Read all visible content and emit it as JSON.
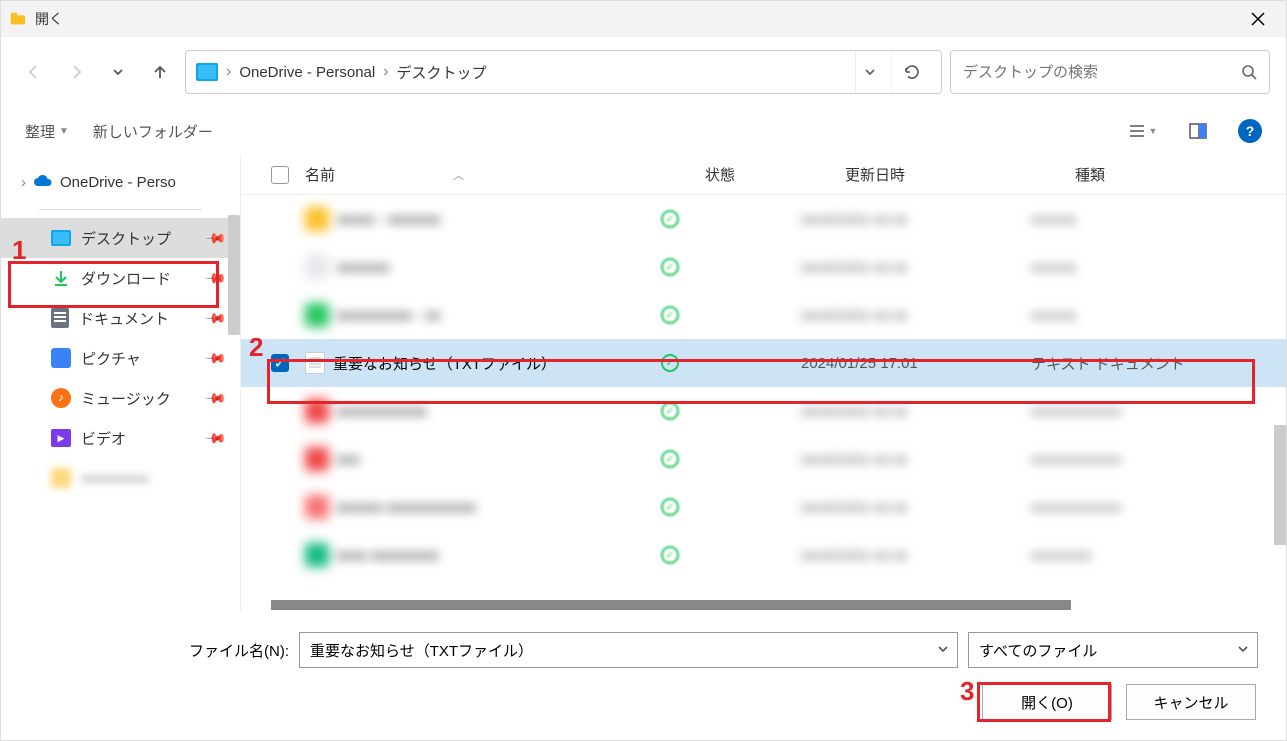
{
  "titlebar": {
    "title": "開く"
  },
  "nav": {
    "breadcrumb": [
      "OneDrive - Personal",
      "デスクトップ"
    ],
    "search_placeholder": "デスクトップの検索"
  },
  "toolbar": {
    "organize": "整理",
    "newfolder": "新しいフォルダー"
  },
  "sidebar": {
    "onedrive": "OneDrive - Perso",
    "items": [
      {
        "label": "デスクトップ",
        "selected": true
      },
      {
        "label": "ダウンロード"
      },
      {
        "label": "ドキュメント"
      },
      {
        "label": "ピクチャ"
      },
      {
        "label": "ミュージック"
      },
      {
        "label": "ビデオ"
      }
    ]
  },
  "columns": {
    "name": "名前",
    "status": "状態",
    "date": "更新日時",
    "type": "種類"
  },
  "files": {
    "selected": {
      "name": "重要なお知らせ（TXTファイル）",
      "date": "2024/01/25 17:01",
      "type": "テキスト ドキュメント"
    }
  },
  "footer": {
    "filename_label": "ファイル名(N):",
    "filename_value": "重要なお知らせ（TXTファイル）",
    "filetype_value": "すべてのファイル",
    "open_btn": "開く(O)",
    "cancel_btn": "キャンセル"
  },
  "annotations": {
    "n1": "1",
    "n2": "2",
    "n3": "3"
  }
}
